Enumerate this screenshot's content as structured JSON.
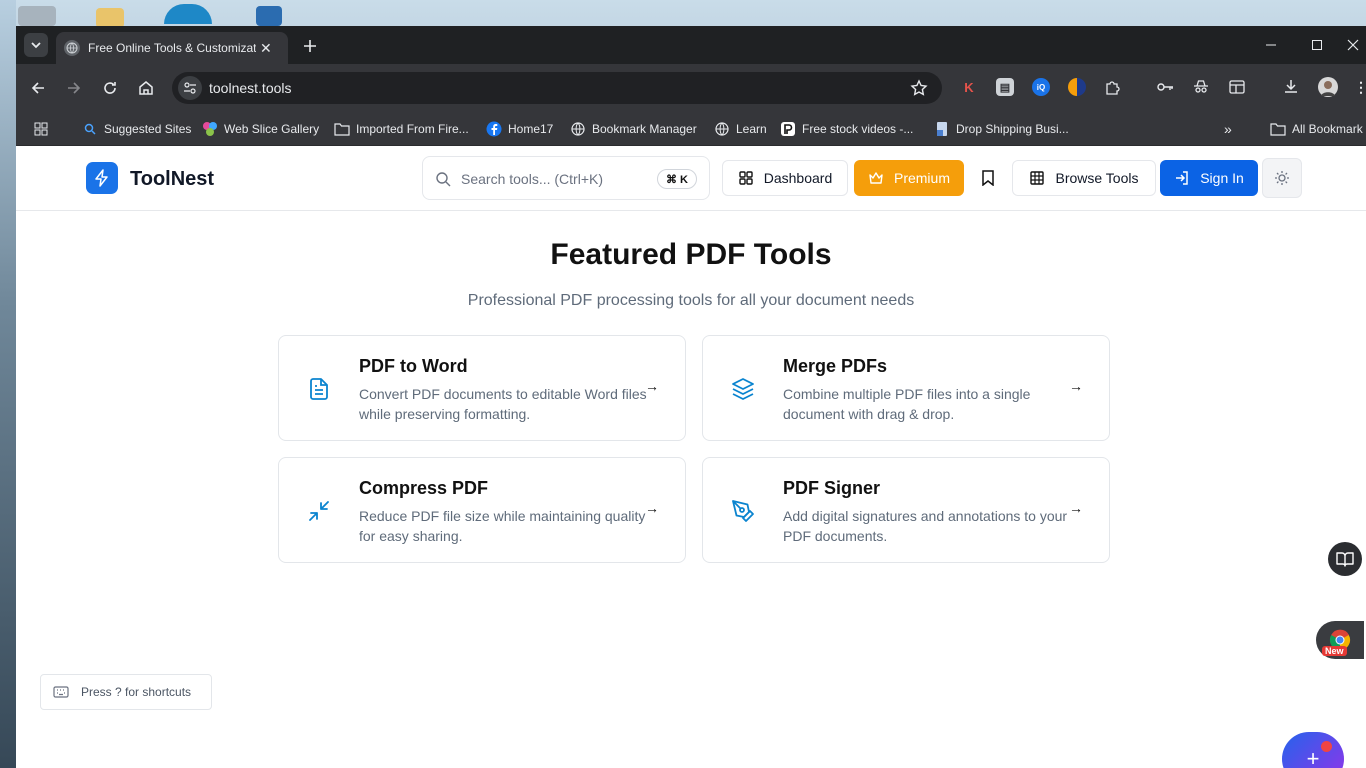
{
  "browser": {
    "tab_title": "Free Online Tools & Customizat",
    "url": "toolnest.tools"
  },
  "bookmarks": [
    {
      "label": "Suggested Sites",
      "icon": "bing-icon"
    },
    {
      "label": "Web Slice Gallery",
      "icon": "web-slice-icon"
    },
    {
      "label": "Imported From Fire...",
      "icon": "folder-icon"
    },
    {
      "label": "Home17",
      "icon": "facebook-icon"
    },
    {
      "label": "Bookmark Manager",
      "icon": "globe-icon"
    },
    {
      "label": "Learn",
      "icon": "globe-icon"
    },
    {
      "label": "Free stock videos -...",
      "icon": "pexels-icon"
    },
    {
      "label": "Drop Shipping Busi...",
      "icon": "page-icon"
    }
  ],
  "all_bookmarks_label": "All Bookmark",
  "header": {
    "brand": "ToolNest",
    "search_placeholder": "Search tools... (Ctrl+K)",
    "search_shortcut": "⌘ K",
    "dashboard_label": "Dashboard",
    "premium_label": "Premium",
    "browse_label": "Browse Tools",
    "signin_label": "Sign In"
  },
  "main": {
    "title": "Featured PDF Tools",
    "subtitle": "Professional PDF processing tools for all your document needs",
    "tools": [
      {
        "title": "PDF to Word",
        "description": "Convert PDF documents to editable Word files while preserving formatting.",
        "icon": "file-text-icon",
        "arrow": "→"
      },
      {
        "title": "Merge PDFs",
        "description": "Combine multiple PDF files into a single document with drag & drop.",
        "icon": "layers-icon",
        "arrow": "→"
      },
      {
        "title": "Compress PDF",
        "description": "Reduce PDF file size while maintaining quality for easy sharing.",
        "icon": "minimize-icon",
        "arrow": "→"
      },
      {
        "title": "PDF Signer",
        "description": "Add digital signatures and annotations to your PDF documents.",
        "icon": "pen-tool-icon",
        "arrow": "→"
      }
    ]
  },
  "shortcut_hint": "Press ? for shortcuts",
  "new_badge": "New",
  "fab_label": "+",
  "colors": {
    "brand_blue": "#1a73e8",
    "premium": "#f59e0b",
    "signin": "#0b63e5",
    "icon_accent": "#0b84cf"
  }
}
